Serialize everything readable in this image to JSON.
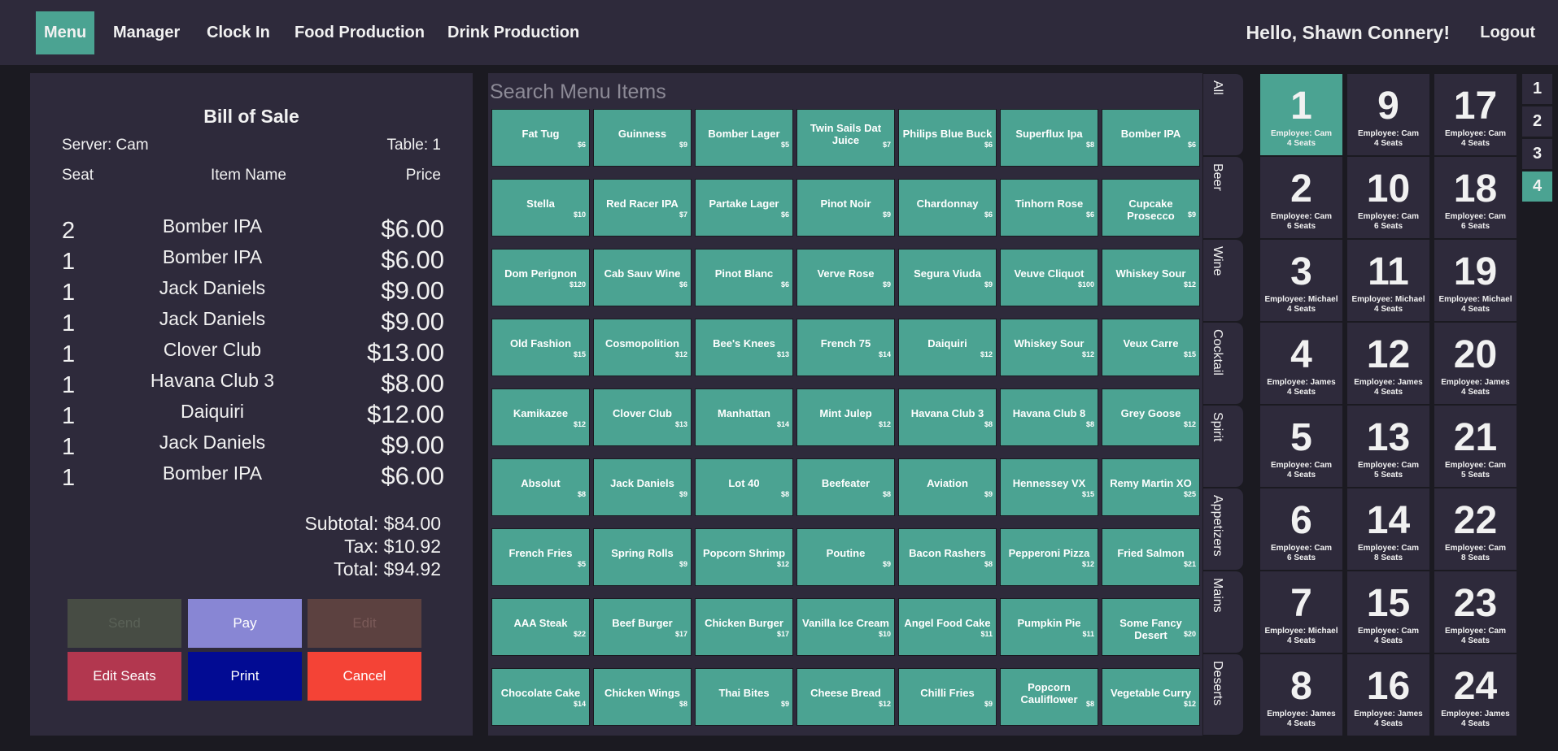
{
  "nav": {
    "items": [
      {
        "label": "Menu",
        "active": true
      },
      {
        "label": "Manager",
        "active": false
      },
      {
        "label": "Clock In",
        "active": false
      },
      {
        "label": "Food Production",
        "active": false
      },
      {
        "label": "Drink Production",
        "active": false
      }
    ],
    "greeting": "Hello, Shawn Connery!",
    "logout": "Logout"
  },
  "bill": {
    "title": "Bill of Sale",
    "server": "Server: Cam",
    "table": "Table: 1",
    "headers": {
      "seat": "Seat",
      "item": "Item Name",
      "price": "Price"
    },
    "items": [
      {
        "seat": "2",
        "name": "Bomber IPA",
        "price": "$6.00"
      },
      {
        "seat": "1",
        "name": "Bomber IPA",
        "price": "$6.00"
      },
      {
        "seat": "1",
        "name": "Jack Daniels",
        "price": "$9.00"
      },
      {
        "seat": "1",
        "name": "Jack Daniels",
        "price": "$9.00"
      },
      {
        "seat": "1",
        "name": "Clover Club",
        "price": "$13.00"
      },
      {
        "seat": "1",
        "name": "Havana Club 3",
        "price": "$8.00"
      },
      {
        "seat": "1",
        "name": "Daiquiri",
        "price": "$12.00"
      },
      {
        "seat": "1",
        "name": "Jack Daniels",
        "price": "$9.00"
      },
      {
        "seat": "1",
        "name": "Bomber IPA",
        "price": "$6.00"
      }
    ],
    "subtotal": "Subtotal: $84.00",
    "tax": "Tax: $10.92",
    "total": "Total: $94.92",
    "buttons": {
      "send": "Send",
      "pay": "Pay",
      "edit": "Edit",
      "edit_seats": "Edit Seats",
      "print": "Print",
      "cancel": "Cancel"
    }
  },
  "search": {
    "placeholder": "Search Menu Items"
  },
  "menu_items": [
    [
      {
        "name": "Fat Tug",
        "price": "$6"
      },
      {
        "name": "Guinness",
        "price": "$9"
      },
      {
        "name": "Bomber Lager",
        "price": "$5"
      },
      {
        "name": "Twin Sails Dat Juice",
        "price": "$7"
      },
      {
        "name": "Philips Blue Buck",
        "price": "$6"
      },
      {
        "name": "Superflux Ipa",
        "price": "$8"
      },
      {
        "name": "Bomber IPA",
        "price": "$6"
      }
    ],
    [
      {
        "name": "Stella",
        "price": "$10"
      },
      {
        "name": "Red Racer IPA",
        "price": "$7"
      },
      {
        "name": "Partake Lager",
        "price": "$6"
      },
      {
        "name": "Pinot Noir",
        "price": "$9"
      },
      {
        "name": "Chardonnay",
        "price": "$6"
      },
      {
        "name": "Tinhorn Rose",
        "price": "$6"
      },
      {
        "name": "Cupcake Prosecco",
        "price": "$9"
      }
    ],
    [
      {
        "name": "Dom Perignon",
        "price": "$120"
      },
      {
        "name": "Cab Sauv Wine",
        "price": "$6"
      },
      {
        "name": "Pinot Blanc",
        "price": "$6"
      },
      {
        "name": "Verve Rose",
        "price": "$9"
      },
      {
        "name": "Segura Viuda",
        "price": "$9"
      },
      {
        "name": "Veuve Cliquot",
        "price": "$100"
      },
      {
        "name": "Whiskey Sour",
        "price": "$12"
      }
    ],
    [
      {
        "name": "Old Fashion",
        "price": "$15"
      },
      {
        "name": "Cosmopolition",
        "price": "$12"
      },
      {
        "name": "Bee's Knees",
        "price": "$13"
      },
      {
        "name": "French 75",
        "price": "$14"
      },
      {
        "name": "Daiquiri",
        "price": "$12"
      },
      {
        "name": "Whiskey Sour",
        "price": "$12"
      },
      {
        "name": "Veux Carre",
        "price": "$15"
      }
    ],
    [
      {
        "name": "Kamikazee",
        "price": "$12"
      },
      {
        "name": "Clover Club",
        "price": "$13"
      },
      {
        "name": "Manhattan",
        "price": "$14"
      },
      {
        "name": "Mint Julep",
        "price": "$12"
      },
      {
        "name": "Havana Club 3",
        "price": "$8"
      },
      {
        "name": "Havana Club 8",
        "price": "$8"
      },
      {
        "name": "Grey Goose",
        "price": "$12"
      }
    ],
    [
      {
        "name": "Absolut",
        "price": "$8"
      },
      {
        "name": "Jack Daniels",
        "price": "$9"
      },
      {
        "name": "Lot 40",
        "price": "$8"
      },
      {
        "name": "Beefeater",
        "price": "$8"
      },
      {
        "name": "Aviation",
        "price": "$9"
      },
      {
        "name": "Hennessey VX",
        "price": "$15"
      },
      {
        "name": "Remy Martin XO",
        "price": "$25"
      }
    ],
    [
      {
        "name": "French Fries",
        "price": "$5"
      },
      {
        "name": "Spring Rolls",
        "price": "$9"
      },
      {
        "name": "Popcorn Shrimp",
        "price": "$12"
      },
      {
        "name": "Poutine",
        "price": "$9"
      },
      {
        "name": "Bacon Rashers",
        "price": "$8"
      },
      {
        "name": "Pepperoni Pizza",
        "price": "$12"
      },
      {
        "name": "Fried Salmon",
        "price": "$21"
      }
    ],
    [
      {
        "name": "AAA Steak",
        "price": "$22"
      },
      {
        "name": "Beef Burger",
        "price": "$17"
      },
      {
        "name": "Chicken Burger",
        "price": "$17"
      },
      {
        "name": "Vanilla Ice Cream",
        "price": "$10"
      },
      {
        "name": "Angel Food Cake",
        "price": "$11"
      },
      {
        "name": "Pumpkin Pie",
        "price": "$11"
      },
      {
        "name": "Some Fancy Desert",
        "price": "$20"
      }
    ],
    [
      {
        "name": "Chocolate Cake",
        "price": "$14"
      },
      {
        "name": "Chicken Wings",
        "price": "$8"
      },
      {
        "name": "Thai Bites",
        "price": "$9"
      },
      {
        "name": "Cheese Bread",
        "price": "$12"
      },
      {
        "name": "Chilli Fries",
        "price": "$9"
      },
      {
        "name": "Popcorn Cauliflower",
        "price": "$8"
      },
      {
        "name": "Vegetable Curry",
        "price": "$12"
      }
    ]
  ],
  "categories": [
    "All",
    "Beer",
    "Wine",
    "Cocktail",
    "Spirit",
    "Appetizers",
    "Mains",
    "Deserts"
  ],
  "tables": [
    {
      "number": "1",
      "employee": "Employee: Cam",
      "seats": "4 Seats",
      "active": true
    },
    {
      "number": "9",
      "employee": "Employee: Cam",
      "seats": "4 Seats"
    },
    {
      "number": "17",
      "employee": "Employee: Cam",
      "seats": "4 Seats"
    },
    {
      "number": "2",
      "employee": "Employee: Cam",
      "seats": "6 Seats"
    },
    {
      "number": "10",
      "employee": "Employee: Cam",
      "seats": "6 Seats"
    },
    {
      "number": "18",
      "employee": "Employee: Cam",
      "seats": "6 Seats"
    },
    {
      "number": "3",
      "employee": "Employee: Michael",
      "seats": "4 Seats"
    },
    {
      "number": "11",
      "employee": "Employee: Michael",
      "seats": "4 Seats"
    },
    {
      "number": "19",
      "employee": "Employee: Michael",
      "seats": "4 Seats"
    },
    {
      "number": "4",
      "employee": "Employee: James",
      "seats": "4 Seats"
    },
    {
      "number": "12",
      "employee": "Employee: James",
      "seats": "4 Seats"
    },
    {
      "number": "20",
      "employee": "Employee: James",
      "seats": "4 Seats"
    },
    {
      "number": "5",
      "employee": "Employee: Cam",
      "seats": "4 Seats"
    },
    {
      "number": "13",
      "employee": "Employee: Cam",
      "seats": "5 Seats"
    },
    {
      "number": "21",
      "employee": "Employee: Cam",
      "seats": "5 Seats"
    },
    {
      "number": "6",
      "employee": "Employee: Cam",
      "seats": "6 Seats"
    },
    {
      "number": "14",
      "employee": "Employee: Cam",
      "seats": "8 Seats"
    },
    {
      "number": "22",
      "employee": "Employee: Cam",
      "seats": "8 Seats"
    },
    {
      "number": "7",
      "employee": "Employee: Michael",
      "seats": "4 Seats"
    },
    {
      "number": "15",
      "employee": "Employee: Cam",
      "seats": "4 Seats"
    },
    {
      "number": "23",
      "employee": "Employee: Cam",
      "seats": "4 Seats"
    },
    {
      "number": "8",
      "employee": "Employee: James",
      "seats": "4 Seats"
    },
    {
      "number": "16",
      "employee": "Employee: James",
      "seats": "4 Seats"
    },
    {
      "number": "24",
      "employee": "Employee: James",
      "seats": "4 Seats"
    }
  ],
  "pages": [
    {
      "label": "1",
      "active": false
    },
    {
      "label": "2",
      "active": false
    },
    {
      "label": "3",
      "active": false
    },
    {
      "label": "4",
      "active": true
    }
  ],
  "colors": {
    "accent": "#4ba392",
    "panel": "#2e2a3b",
    "background": "#1b1a21",
    "send": "#474c44",
    "pay": "#8886d4",
    "edit": "#5c4140",
    "edit_seats": "#b2374f",
    "print": "#020b93",
    "cancel": "#f44336"
  }
}
